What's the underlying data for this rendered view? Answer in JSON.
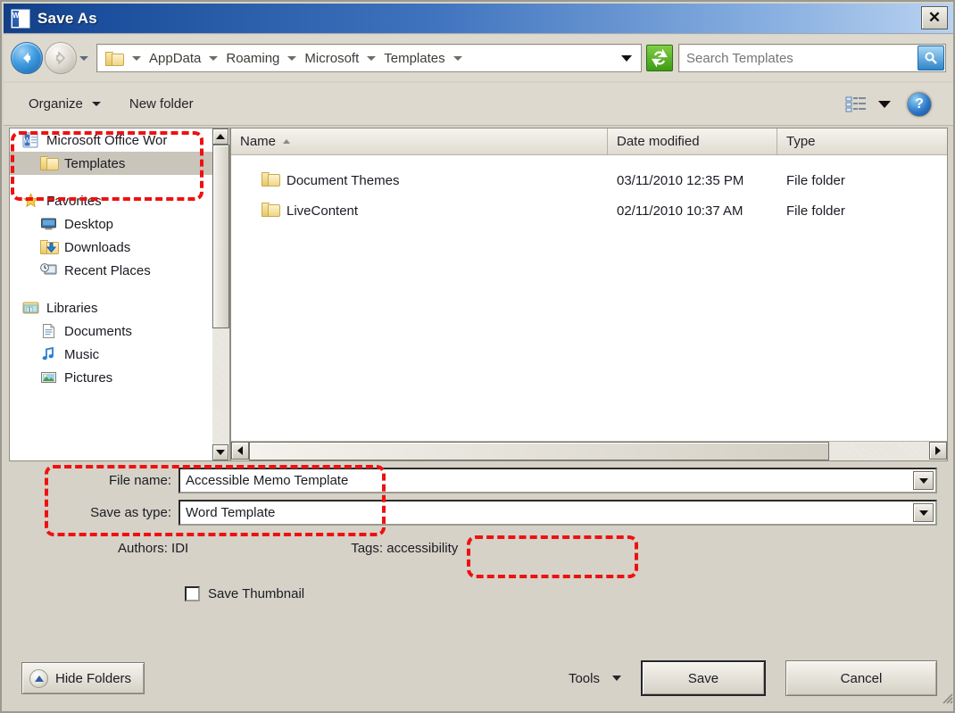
{
  "window": {
    "title": "Save As",
    "app_icon": "word-document-icon",
    "close_label": "✕"
  },
  "navigation": {
    "back_icon": "back-arrow-icon",
    "forward_icon": "forward-arrow-icon",
    "history_icon": "recent-pages-chevron-icon",
    "breadcrumbs": [
      "AppData",
      "Roaming",
      "Microsoft",
      "Templates"
    ],
    "address_dropdown_icon": "chevron-down-icon",
    "refresh_icon": "refresh-icon",
    "search": {
      "value": "",
      "placeholder": "Search Templates",
      "button_icon": "search-magnifier-icon"
    }
  },
  "toolbar": {
    "organize_label": "Organize",
    "new_folder_label": "New folder",
    "view_icon": "view-list-icon",
    "view_dropdown_icon": "chevron-down-icon",
    "help_label": "?",
    "help_icon": "help-icon"
  },
  "sidebar": {
    "items": [
      {
        "label": "Microsoft Office Wor",
        "icon": "word-app-icon",
        "indent": false,
        "selected": false
      },
      {
        "label": "Templates",
        "icon": "folder-icon",
        "indent": true,
        "selected": true
      },
      {
        "label": "Favorites",
        "icon": "star-icon",
        "indent": false,
        "selected": false
      },
      {
        "label": "Desktop",
        "icon": "desktop-icon",
        "indent": true,
        "selected": false
      },
      {
        "label": "Downloads",
        "icon": "downloads-icon",
        "indent": true,
        "selected": false
      },
      {
        "label": "Recent Places",
        "icon": "recent-places-icon",
        "indent": true,
        "selected": false
      },
      {
        "label": "Libraries",
        "icon": "libraries-icon",
        "indent": false,
        "selected": false
      },
      {
        "label": "Documents",
        "icon": "document-icon",
        "indent": true,
        "selected": false
      },
      {
        "label": "Music",
        "icon": "music-note-icon",
        "indent": true,
        "selected": false
      },
      {
        "label": "Pictures",
        "icon": "picture-icon",
        "indent": true,
        "selected": false
      }
    ],
    "scroll_up_icon": "scroll-up-arrow-icon",
    "scroll_down_icon": "scroll-down-arrow-icon"
  },
  "filelist": {
    "columns": [
      {
        "label": "Name",
        "sorted": true,
        "sort_icon": "sort-ascending-icon"
      },
      {
        "label": "Date modified",
        "sorted": false
      },
      {
        "label": "Type",
        "sorted": false
      }
    ],
    "rows": [
      {
        "name": "Document Themes",
        "date_modified": "03/11/2010 12:35 PM",
        "type": "File folder",
        "icon": "folder-icon"
      },
      {
        "name": "LiveContent",
        "date_modified": "02/11/2010 10:37 AM",
        "type": "File folder",
        "icon": "folder-icon"
      }
    ],
    "hscroll_left_icon": "scroll-left-arrow-icon",
    "hscroll_right_icon": "scroll-right-arrow-icon"
  },
  "form": {
    "file_name_label": "File name:",
    "file_name_value": "Accessible Memo Template",
    "save_as_type_label": "Save as type:",
    "save_as_type_value": "Word Template",
    "dropdown_icon": "chevron-down-icon",
    "authors_text": "Authors: IDI",
    "tags_text": "Tags: accessibility",
    "save_thumbnail_label": "Save Thumbnail",
    "save_thumbnail_checked": false
  },
  "footer": {
    "hide_folders_label": "Hide Folders",
    "hide_folders_icon": "collapse-up-icon",
    "tools_label": "Tools",
    "tools_dropdown_icon": "chevron-down-icon",
    "save_label": "Save",
    "cancel_label": "Cancel",
    "resize_grip_icon": "resize-grip-icon"
  },
  "annotations": {
    "color": "#ee1111",
    "boxes": [
      "sidebar-templates-highlight",
      "file-name-and-type-highlight",
      "tags-highlight"
    ]
  }
}
